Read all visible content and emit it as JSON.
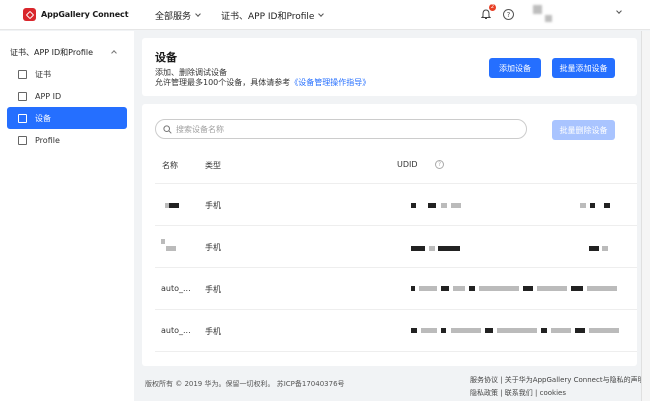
{
  "brand": {
    "name": "AppGallery Connect"
  },
  "topnav": {
    "all_services": "全部服务",
    "cert_menu": "证书、APP ID和Profile",
    "notification_count": "2",
    "help": "?"
  },
  "sidebar": {
    "group": "证书、APP ID和Profile",
    "items": [
      {
        "label": "证书"
      },
      {
        "label": "APP ID"
      },
      {
        "label": "设备"
      },
      {
        "label": "Profile"
      }
    ]
  },
  "header": {
    "title": "设备",
    "desc_line1": "添加、删除调试设备",
    "desc_line2_prefix": "允许管理最多100个设备，具体请参考",
    "desc_line2_link": "《设备管理操作指导》",
    "add_button": "添加设备",
    "bulk_add_button": "批量添加设备"
  },
  "table": {
    "search_placeholder": "搜索设备名称",
    "bulk_delete_button": "批量删除设备",
    "columns": [
      "名称",
      "类型",
      "UDID"
    ],
    "rows": [
      {
        "name": "",
        "type": "手机"
      },
      {
        "name": "",
        "type": "手机"
      },
      {
        "name": "auto_...",
        "type": "手机"
      },
      {
        "name": "auto_...",
        "type": "手机"
      }
    ]
  },
  "footer": {
    "copyright": "版权所有 © 2019 华为。保留一切权利。 苏ICP备17040376号",
    "links_line1": "服务协议 | 关于华为AppGallery Connect与隐私的声明",
    "links_line2": "隐私政策 | 联系我们 | cookies"
  },
  "colors": {
    "accent": "#256fff",
    "brand_red": "#d9262c"
  }
}
